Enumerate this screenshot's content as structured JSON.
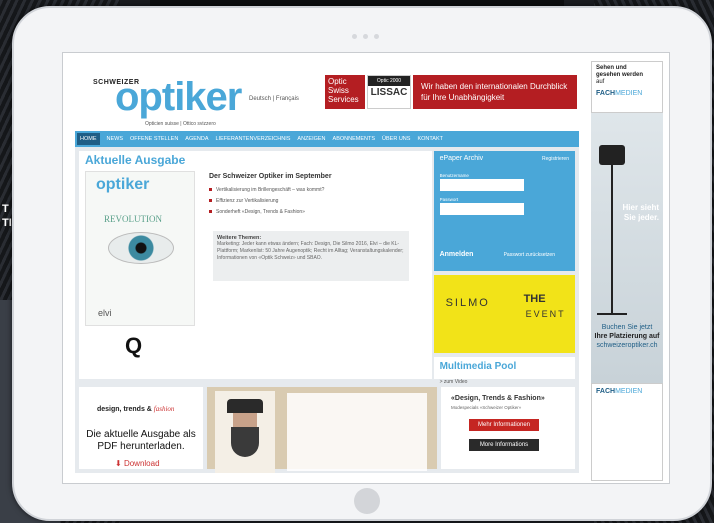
{
  "background": {
    "text_line1": "T",
    "text_line2": "TI"
  },
  "site": {
    "logo_small": "SCHWEIZER",
    "logo": "optiker",
    "logo_tagline": "Opticien suisse | Ottico svizzero",
    "languages": "Deutsch | Français",
    "ads": {
      "optic": "Optic Swiss Services",
      "lissac_top": "Optic 2000",
      "lissac": "LISSAC",
      "durchblick": "Wir haben den internationalen Durchblick für Ihre Unabhängigkeit"
    },
    "nav": [
      "HOME",
      "NEWS",
      "OFFENE STELLEN",
      "AGENDA",
      "LIEFERANTENVERZEICHNIS",
      "ANZEIGEN",
      "ABONNEMENTS",
      "ÜBER UNS",
      "KONTAKT"
    ],
    "aktuelle_ausgabe": "Aktuelle Ausgabe",
    "cover": {
      "title": "optiker",
      "headline": "REVOLUTION",
      "brand": "elvi"
    },
    "q_logo": "Q",
    "article": {
      "title": "Der Schweizer Optiker im September",
      "bullets": [
        "Vertikalisierung im Brillengeschäft – was kommt?",
        "Effizienz zur Vertikalisierung",
        "Sonderheft «Design, Trends & Fashion»"
      ],
      "more_title": "Weitere Themen:",
      "more_text": "Marketing: Jeder kann etwas ändern; Fach: Design, Die Silmo 2016, Elvi – die KL-Plattform; Markenlist: 50 Jahre Augenoptik; Recht im Alltag; Veranstaltungskalender; Informationen von «Optik Schweiz» und SBAO."
    },
    "login": {
      "title": "ePaper Archiv",
      "register": "Registrieren",
      "user_label": "Benutzername",
      "pass_label": "Passwort",
      "button": "Anmelden",
      "forgot": "Passwort zurücksetzen"
    },
    "silmo": {
      "left": "SILMO",
      "right_top": "THE",
      "right_bottom": "EVENT"
    },
    "multimedia": {
      "title": "Multimedia Pool",
      "link": "> zum Video"
    },
    "bottom": {
      "dtf_prefix": "design, trends & ",
      "dtf_fashion": "fashion",
      "pdf_text": "Die aktuelle Ausgabe als PDF herunterladen.",
      "download": "Download",
      "fashion_title": "«Design, Trends & Fashion»",
      "fashion_sub": "Modespecials «Schweizer Optiker»",
      "mehr": "Mehr Informationen",
      "more": "More Informations"
    }
  },
  "sky": {
    "top_line1": "Sehen und",
    "top_line2": "gesehen werden",
    "top_line3": "auf",
    "fach": "FACH",
    "medien": "MEDIEN",
    "hier": "Hier sieht Sie jeder.",
    "buchen": "Buchen Sie jetzt",
    "platz": "Ihre Platzierung auf",
    "url": "schweizeroptiker.ch"
  }
}
